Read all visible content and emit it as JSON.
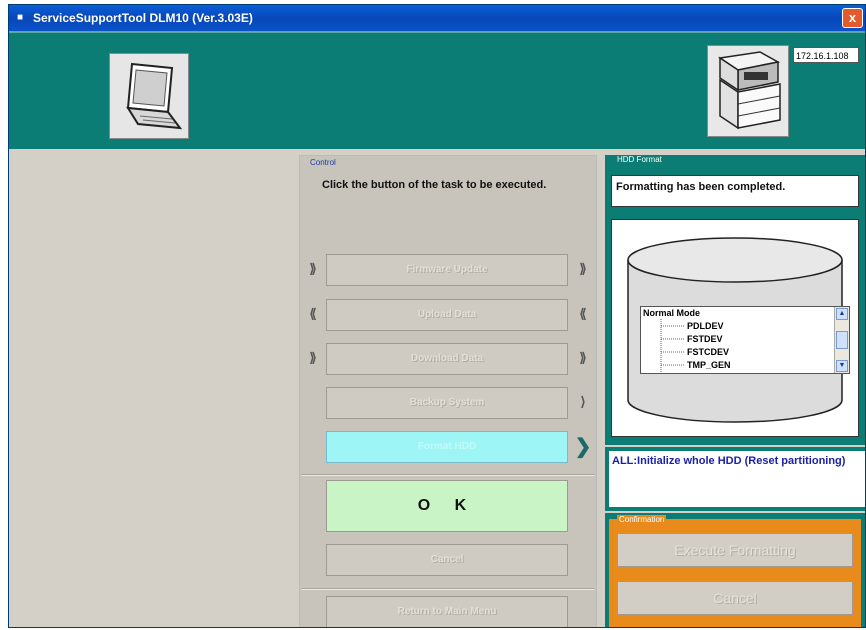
{
  "window": {
    "title": "ServiceSupportTool DLM10 (Ver.3.03E)",
    "close_glyph": "x"
  },
  "header": {
    "ip_address": "172.16.1.108",
    "laptop_icon": "laptop-icon",
    "printer_icon": "printer-icon"
  },
  "control": {
    "group_label": "Control",
    "instruction": "Click the button of the task to be executed.",
    "buttons": {
      "firmware": "Firmware Update",
      "upload": "Upload Data",
      "download": "Download Data",
      "backup": "Backup System",
      "format": "Format HDD",
      "ok": "O K",
      "cancel": "Cancel",
      "return": "Return to Main Menu"
    },
    "arrows": {
      "right": "⟫",
      "left": "⟪",
      "single": "⟩",
      "active": "❯"
    }
  },
  "hdd": {
    "group_label": "HDD Format",
    "message": "Formatting has been completed.",
    "list": {
      "items": [
        "Normal Mode",
        "PDLDEV",
        "FSTDEV",
        "FSTCDEV",
        "TMP_GEN"
      ],
      "up_glyph": "▲",
      "down_glyph": "▼"
    },
    "description": "ALL:Initialize whole HDD (Reset partitioning)"
  },
  "confirmation": {
    "group_label": "Confirmation",
    "execute": "Execute Formatting",
    "cancel": "Cancel"
  },
  "colors": {
    "title_blue": "#0a52c8",
    "teal": "#0b7d74",
    "format_cyan": "#9ef5f5",
    "ok_green": "#c9f5c6",
    "confirm_orange": "#e88a1c"
  }
}
